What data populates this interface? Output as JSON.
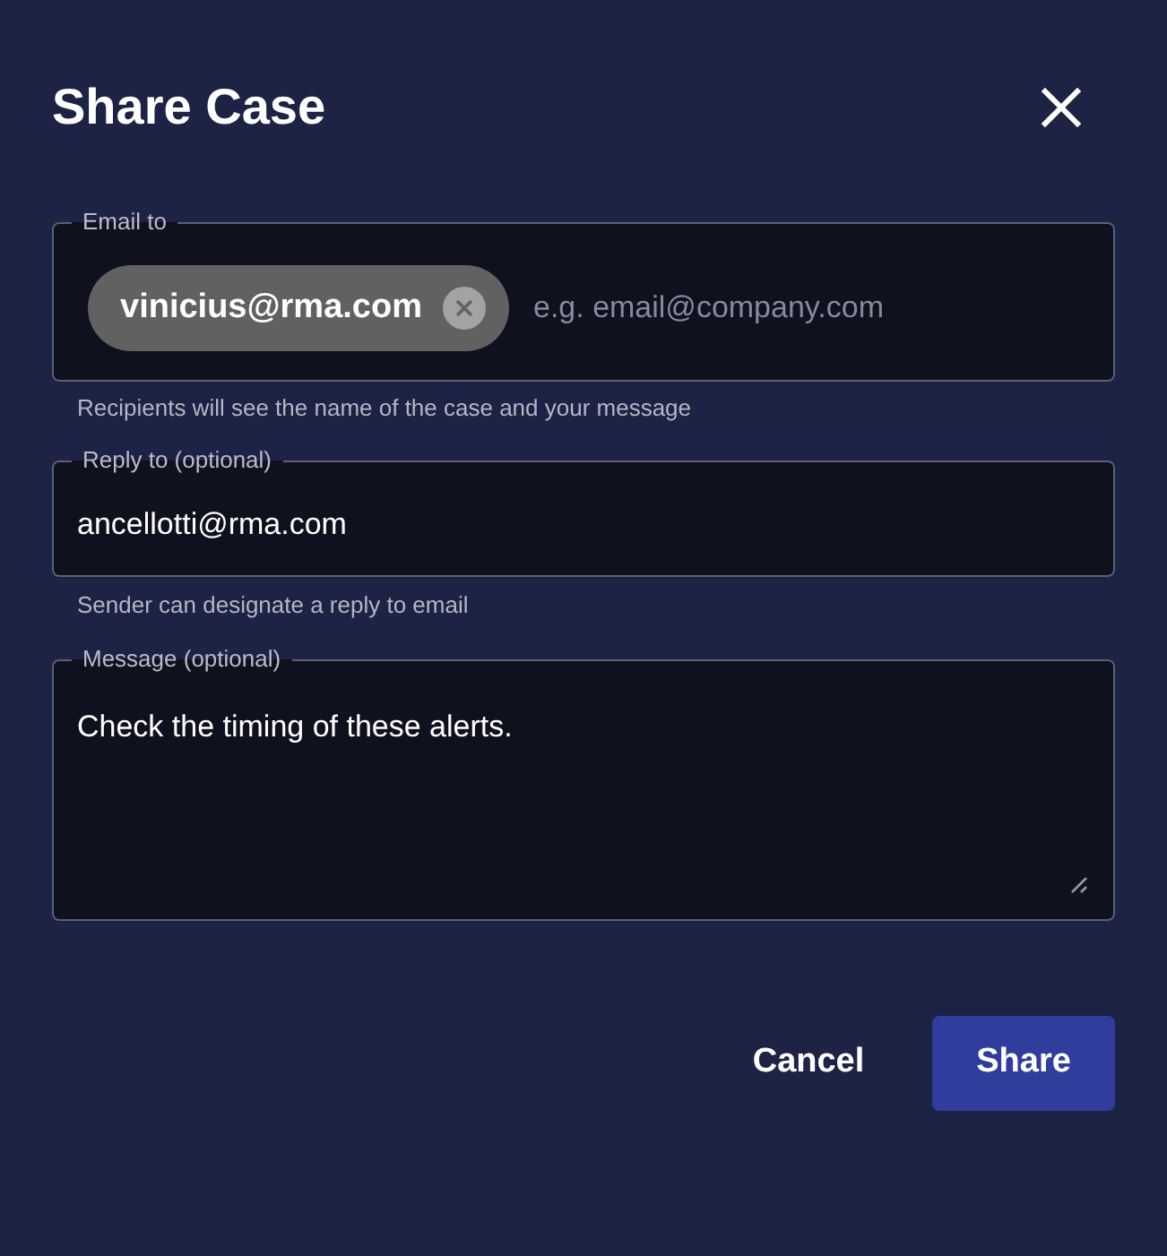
{
  "dialog": {
    "title": "Share Case"
  },
  "fields": [
    {
      "kind": "chips",
      "label": "Email to",
      "chips": [
        {
          "label": "vinicius@rma.com"
        }
      ],
      "placeholder": "e.g. email@company.com",
      "helper": "Recipients will see the name of the case and your message"
    },
    {
      "kind": "text",
      "label": "Reply to (optional)",
      "value": "ancellotti@rma.com",
      "helper": "Sender can designate a reply to email"
    },
    {
      "kind": "multiline",
      "label": "Message (optional)",
      "value": "Check the timing of these alerts."
    }
  ],
  "actions": [
    {
      "kind": "text",
      "label": "Cancel"
    },
    {
      "kind": "primary",
      "label": "Share"
    }
  ]
}
